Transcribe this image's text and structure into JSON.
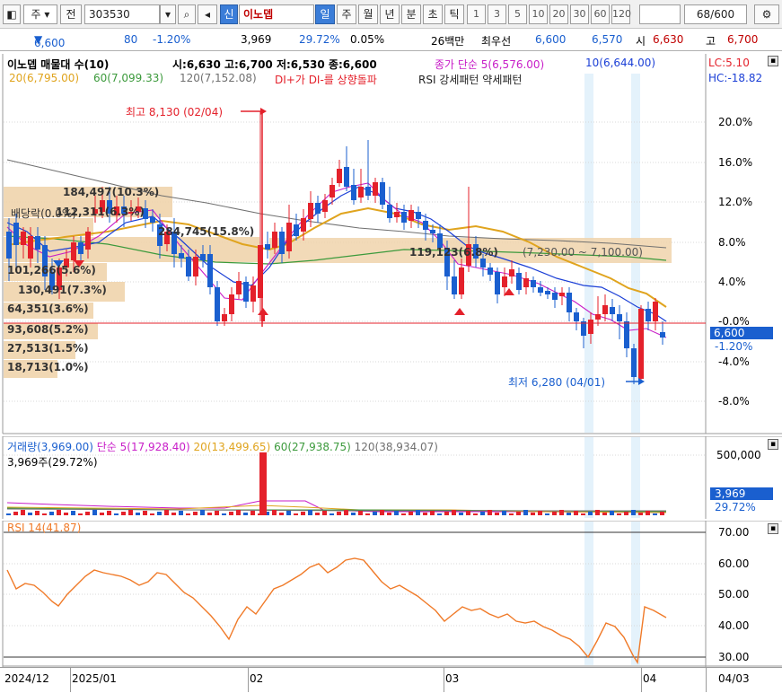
{
  "toolbar": {
    "market_label": "주",
    "code_label": "전",
    "stock_code": "303530",
    "new_badge": "신",
    "stock_name": "이노뎁",
    "period_tabs": [
      "일",
      "주",
      "월",
      "년",
      "분",
      "초",
      "틱"
    ],
    "active_period": "일",
    "intervals": [
      "1",
      "3",
      "5",
      "10",
      "20",
      "30",
      "60",
      "120"
    ],
    "page_counter": "68/600"
  },
  "quote": {
    "price": "6,600",
    "change": "80",
    "change_pct": "-1.20%",
    "volume": "3,969",
    "volume_ratio": "29.72%",
    "turnover_pct": "0.05%",
    "amount": "26백만",
    "best_label": "최우선",
    "ask": "6,600",
    "bid": "6,570",
    "open_label": "시",
    "open": "6,630",
    "high_label": "고",
    "high": "6,700"
  },
  "legend": {
    "title": "이노뎁 매물대 수(10)",
    "ohlc": "시:6,630 고:6,700 저:6,530 종:6,600",
    "ma_close": "종가 단순 5(6,576.00)",
    "ma10": "10(6,644.00)",
    "ma20": "20(6,795.00)",
    "ma60": "60(7,099.33)",
    "ma120": "120(7,152.08)",
    "dmi_signal": "DI+가 DI-를 상향돌파",
    "rsi_pattern": "RSI 강세패턴  약세패턴",
    "lc": "LC:5.10",
    "hc": "HC:-18.82"
  },
  "annotations": {
    "high_mark": "최고 8,130 (02/04)",
    "low_mark": "최저 6,280 (04/01)",
    "dividend": "배당락(0.0%)",
    "current_price": "6,600",
    "current_pct": "-1.20%"
  },
  "volume_profile": [
    "184,497(10.3%)",
    "112,311(6.3%)",
    "284,745(15.8%)",
    "101,266(5.6%)",
    "130,491(7.3%)",
    "64,351(3.6%)",
    "93,608(5.2%)",
    "27,513(1.5%)",
    "18,713(1.0%)",
    "119,123(6.8%)"
  ],
  "range_label": "(7,230.00 ~ 7,100.00)",
  "price_axis": [
    "20.0%",
    "16.0%",
    "12.0%",
    "8.0%",
    "4.0%",
    "-0.0%",
    "-4.0%",
    "-8.0%"
  ],
  "volume_legend": {
    "title": "거래량(3,969.00)",
    "ma5": "단순 5(17,928.40)",
    "ma20": "20(13,499.65)",
    "ma60": "60(27,938.75)",
    "ma120": "120(38,934.07)",
    "shares": "3,969주(29.72%)",
    "current": "3,969",
    "current_pct": "29.72%",
    "axis": "500,000"
  },
  "rsi_legend": {
    "title": "RSI 14(41.87)",
    "axis": [
      "70.00",
      "60.00",
      "50.00",
      "40.00",
      "30.00"
    ]
  },
  "time_axis": [
    "2024/12",
    "2025/01",
    "02",
    "03",
    "04",
    "04/03"
  ],
  "colors": {
    "up": "#e4212b",
    "down": "#1a5fcf",
    "ma5": "#c81ec8",
    "ma10": "#1b3fd6",
    "ma20": "#e0a41e",
    "ma60": "#3c9a3c",
    "ma120": "#707070",
    "rsi": "#f07a28",
    "volume_profile": "#f0d4ac"
  }
}
